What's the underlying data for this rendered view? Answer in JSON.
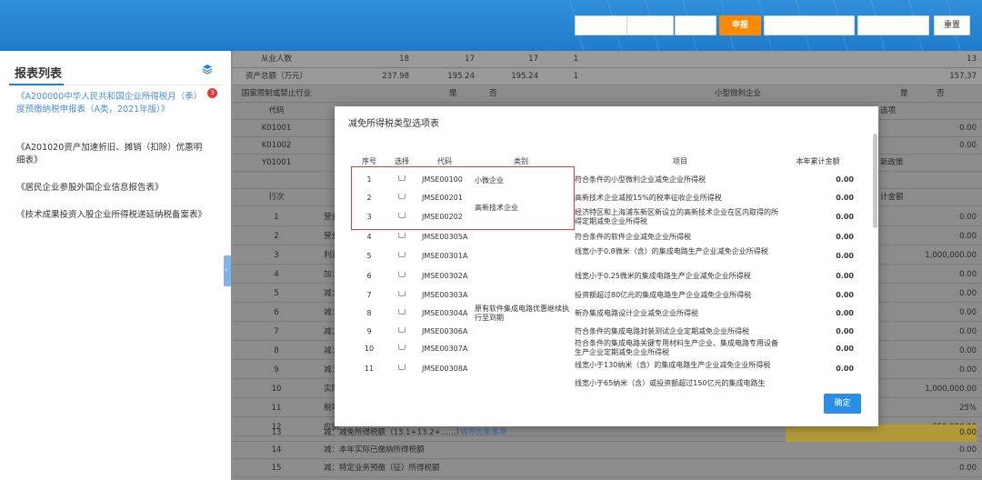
{
  "toolbar": {
    "buttons": [
      {
        "label": "",
        "style": "ghost"
      },
      {
        "label": "",
        "style": "ghost"
      },
      {
        "label": "",
        "style": "ghost"
      },
      {
        "label": "申报",
        "style": "primary"
      },
      {
        "label": "",
        "style": "ghost"
      },
      {
        "label": "",
        "style": "ghost"
      },
      {
        "label": "重置",
        "style": "normal"
      }
    ]
  },
  "sidebar": {
    "title": "报表列表",
    "badge": "3",
    "items": [
      "《A200000中华人民共和国企业所得税月（季）度预缴纳税申报表（A类，2021年版）》",
      "《A201020资产加速折旧、摊销（扣除）优惠明细表》",
      "《居民企业参股外国企业信息报告表》",
      "《技术成果投资入股企业所得税递延纳税备案表》"
    ]
  },
  "background": {
    "rows": [
      {
        "num": "从业人数",
        "v1": "18",
        "v2": "17",
        "v3": "17",
        "v4": "1",
        "right": "13"
      },
      {
        "num": "资产总额（万元）",
        "v1": "237.98",
        "v2": "195.24",
        "v3": "195.24",
        "v4": "1",
        "right": "157.37"
      },
      {
        "num": "国家限制或禁止行业",
        "yes": "是",
        "no": "否",
        "mid": "小型微利企业",
        "yes2": "是",
        "no2": "否"
      },
      {
        "num": "代码",
        "right_label": "选项"
      },
      {
        "num": "K01001",
        "right": "0.00"
      },
      {
        "num": "K01002",
        "right": "0.00"
      },
      {
        "num": "Y01001",
        "right_label2": "新政策"
      },
      {
        "num": "",
        "right": ""
      },
      {
        "num": "行次",
        "right_label": "计金额"
      },
      {
        "num": "1",
        "label": "营业",
        "right": "0.00"
      },
      {
        "num": "2",
        "label": "营业",
        "right": "0.00"
      },
      {
        "num": "3",
        "label": "利润",
        "right": "1,000,000.00"
      },
      {
        "num": "4",
        "label": "加：",
        "right": "0.00"
      },
      {
        "num": "5",
        "label": "减：",
        "right": "0.00"
      },
      {
        "num": "6",
        "label": "减：",
        "right": "0.00"
      },
      {
        "num": "7",
        "label": "减：",
        "right": "0.00"
      },
      {
        "num": "8",
        "label": "减：",
        "right": "0.00"
      },
      {
        "num": "9",
        "label": "减：",
        "right": "0.00"
      },
      {
        "num": "10",
        "label": "实际",
        "right": "1,000,000.00"
      },
      {
        "num": "11",
        "label": "税率",
        "right": "25%"
      },
      {
        "num": "12",
        "label": "应纳",
        "right": "250,000.00"
      },
      {
        "num": "13",
        "label": "减：减免所得税额（13.1+13.2+……）",
        "link": "填写优惠事项",
        "right": "0.00",
        "yellow": true
      },
      {
        "num": "14",
        "label": "减：本年实际已缴纳所得税额",
        "right": "0.00"
      },
      {
        "num": "15",
        "label": "减：特定业务预缴（征）所得税额",
        "right": "0.00"
      }
    ]
  },
  "modal": {
    "title": "减免所得税类型选项表",
    "columns": {
      "seq": "序号",
      "select": "选择",
      "code": "代码",
      "category": "类别",
      "item": "项目",
      "amount": "本年累计金额"
    },
    "rows": [
      {
        "seq": "1",
        "code": "JMSE00100",
        "category": "小微企业",
        "item": "符合条件的小型微利企业减免企业所得税",
        "amount": "0.00"
      },
      {
        "seq": "2",
        "code": "JMSE00201",
        "category": "",
        "item": "高新技术企业减按15%的税率征收企业所得税",
        "amount": "0.00"
      },
      {
        "seq": "3",
        "code": "JMSE00202",
        "category": "",
        "item": "经济特区和上海浦东新区新设立的高新技术企业在区内取得的所得定期减免企业所得税",
        "amount": "0.00"
      },
      {
        "seq": "4",
        "code": "JMSE00305A",
        "category": "",
        "item": "符合条件的软件企业减免企业所得税",
        "amount": "0.00"
      },
      {
        "seq": "5",
        "code": "JMSE00301A",
        "category": "",
        "item": "线宽小于0.8微米（含）的集成电路生产企业减免企业所得税",
        "amount": "0.00"
      },
      {
        "seq": "6",
        "code": "JMSE00302A",
        "category": "",
        "item": "线宽小于0.25微米的集成电路生产企业减免企业所得税",
        "amount": "0.00"
      },
      {
        "seq": "7",
        "code": "JMSE00303A",
        "category": "",
        "item": "投资额超过80亿元的集成电路生产企业减免企业所得税",
        "amount": "0.00"
      },
      {
        "seq": "8",
        "code": "JMSE00304A",
        "category": "",
        "item": "新办集成电路设计企业减免企业所得税",
        "amount": "0.00"
      },
      {
        "seq": "9",
        "code": "JMSE00306A",
        "category": "",
        "item": "符合条件的集成电路封装测试企业定期减免企业所得税",
        "amount": "0.00"
      },
      {
        "seq": "10",
        "code": "JMSE00307A",
        "category": "",
        "item": "符合条件的集成电路关键专用材料生产企业、集成电路专用设备生产企业定期减免企业所得税",
        "amount": "0.00"
      },
      {
        "seq": "11",
        "code": "JMSE00308A",
        "category": "",
        "item": "线宽小于130纳米（含）的集成电路生产企业减免企业所得税",
        "amount": "0.00"
      },
      {
        "seq": "",
        "code": "",
        "category": "",
        "item": "线宽小于65纳米（含）或投资额超过150亿元的集成电路生",
        "amount": ""
      }
    ],
    "category_groups": [
      {
        "label": "高新技术企业"
      },
      {
        "label": "原有软件集成电路优惠继续执行至到期"
      }
    ],
    "ok_label": "确定"
  },
  "colors": {
    "header": "#1f7ccc",
    "accent": "#ff8a00",
    "highlight": "#e53935",
    "primary": "#2b8de3"
  }
}
